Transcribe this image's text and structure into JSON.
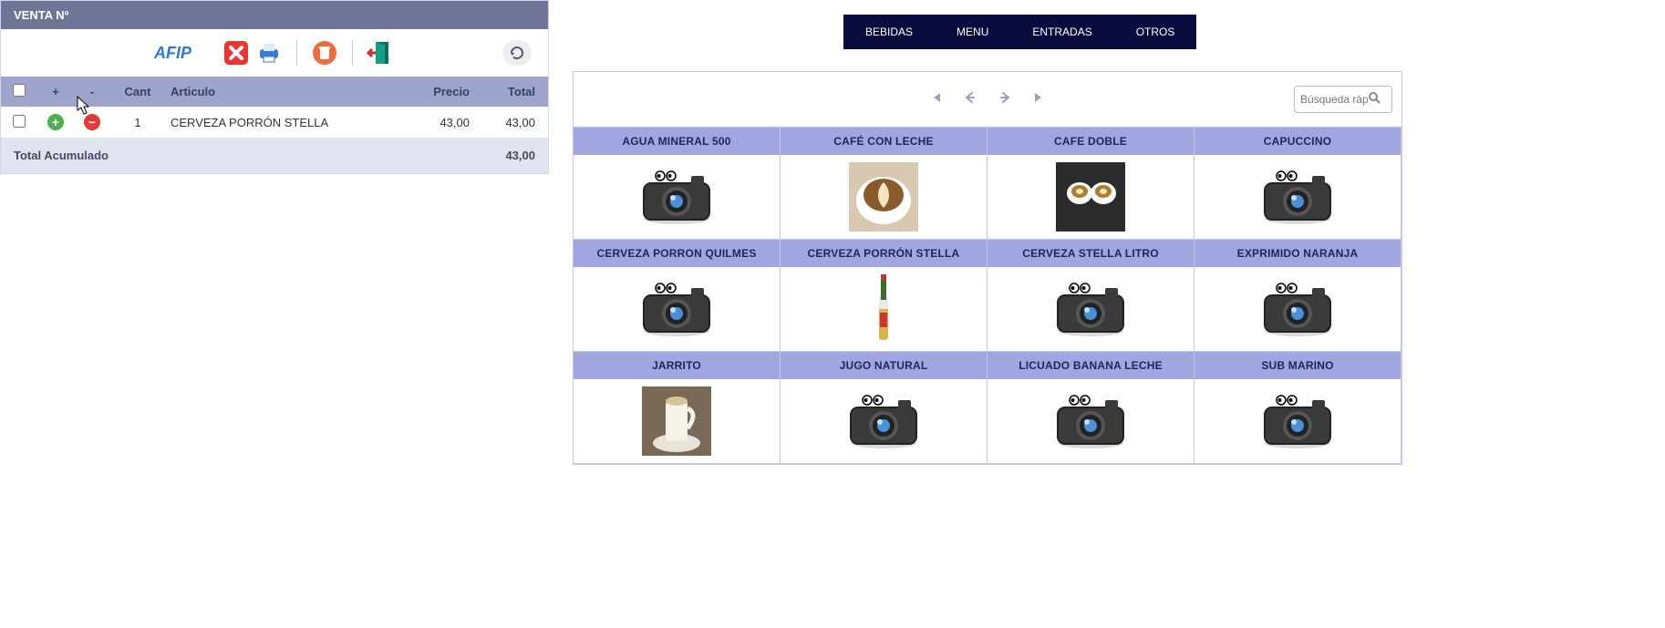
{
  "sale": {
    "header_title": "VENTA Nº",
    "toolbar": {
      "afip_label": "AFIP",
      "cancel": "cancel",
      "print": "print",
      "delete": "delete",
      "exit": "exit",
      "refresh": "refresh"
    },
    "columns": {
      "check": "",
      "plus": "+",
      "minus": "-",
      "qty": "Cant",
      "article": "Articulo",
      "price": "Precio",
      "total": "Total"
    },
    "rows": [
      {
        "qty": "1",
        "article": "CERVEZA PORRÓN STELLA",
        "price": "43,00",
        "total": "43,00"
      }
    ],
    "footer": {
      "label": "Total Acumulado",
      "value": "43,00"
    }
  },
  "nav": {
    "items": [
      "BEBIDAS",
      "MENU",
      "ENTRADAS",
      "OTROS"
    ]
  },
  "catalog": {
    "search_placeholder": "Búsqueda ráp",
    "pager": {
      "first": "⏮",
      "prev": "←",
      "next": "→",
      "last": "⏭"
    },
    "products": [
      {
        "name": "AGUA MINERAL 500",
        "image": "camera"
      },
      {
        "name": "CAFÉ CON LECHE",
        "image": "latte"
      },
      {
        "name": "CAFE DOBLE",
        "image": "double"
      },
      {
        "name": "CAPUCCINO",
        "image": "camera"
      },
      {
        "name": "CERVEZA PORRON QUILMES",
        "image": "camera"
      },
      {
        "name": "CERVEZA PORRÓN STELLA",
        "image": "beer"
      },
      {
        "name": "CERVEZA STELLA LITRO",
        "image": "camera"
      },
      {
        "name": "EXPRIMIDO NARANJA",
        "image": "camera"
      },
      {
        "name": "JARRITO",
        "image": "jarrito"
      },
      {
        "name": "JUGO NATURAL",
        "image": "camera"
      },
      {
        "name": "LICUADO BANANA LECHE",
        "image": "camera"
      },
      {
        "name": "SUB MARINO",
        "image": "camera"
      }
    ]
  }
}
